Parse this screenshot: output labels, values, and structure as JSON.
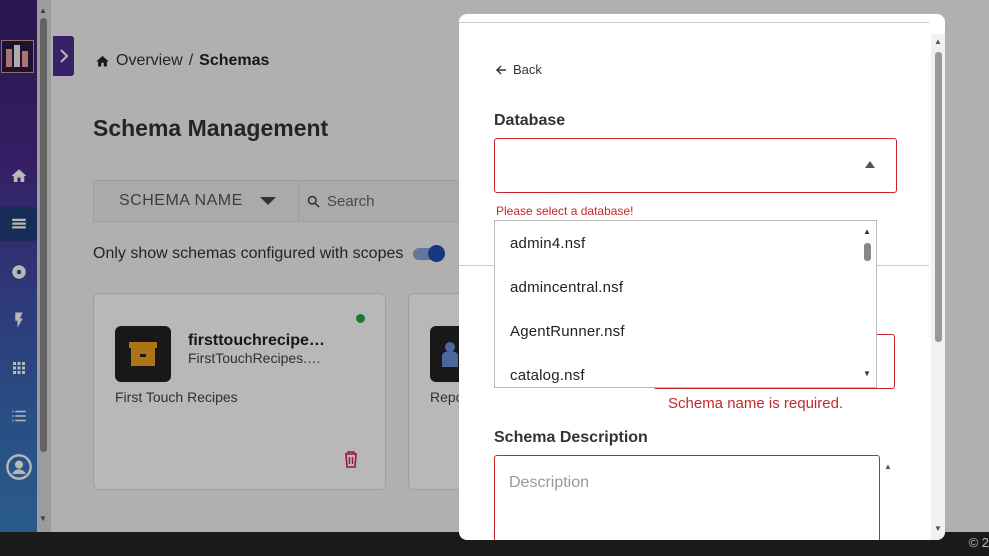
{
  "breadcrumb": {
    "overview": "Overview",
    "separator": "/",
    "current": "Schemas"
  },
  "page_title": "Schema Management",
  "filter": {
    "selected": "SCHEMA NAME",
    "search_placeholder": "Search"
  },
  "toggle_label": "Only show schemas configured with scopes",
  "cards": [
    {
      "title": "firsttouchrecipe…",
      "subtitle": "FirstTouchRecipes.…",
      "description": "First Touch Recipes",
      "status_color": "#28a745"
    },
    {
      "description": "Repo"
    }
  ],
  "sidebar_icons": [
    "home-icon",
    "schemas-icon",
    "database-icon",
    "flash-icon",
    "apps-icon",
    "list-icon",
    "user-icon"
  ],
  "modal": {
    "back_label": "Back",
    "database_label": "Database",
    "database_error": "Please select a database!",
    "database_options": [
      "admin4.nsf",
      "admincentral.nsf",
      "AgentRunner.nsf",
      "catalog.nsf"
    ],
    "schema_name_error": "Schema name is required.",
    "description_label": "Schema Description",
    "description_placeholder": "Description"
  },
  "copyright": "© 2",
  "colors": {
    "error": "#c62828",
    "accent": "#4b2e8e",
    "toggle": "#1f4fb0"
  }
}
